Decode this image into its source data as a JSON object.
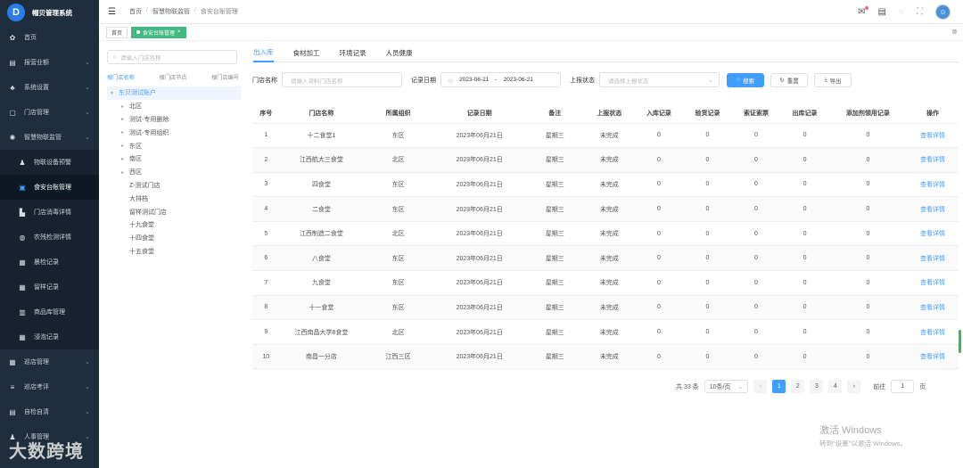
{
  "app": {
    "title": "帽贝管理系统",
    "logo_icon": "D"
  },
  "sidebar": {
    "items": [
      {
        "label": "首页",
        "icon": "home-icon",
        "glyph": "✿",
        "arrow": false
      },
      {
        "label": "报营业额",
        "icon": "document-icon",
        "glyph": "▤",
        "arrow": true
      },
      {
        "label": "系统设置",
        "icon": "user-settings-icon",
        "glyph": "♣",
        "arrow": true
      },
      {
        "label": "门店管理",
        "icon": "store-icon",
        "glyph": "▢",
        "arrow": true
      },
      {
        "label": "智慧物联监管",
        "icon": "gear-icon",
        "glyph": "✺",
        "arrow": true
      }
    ],
    "sub_items": [
      {
        "label": "物联设备预警",
        "icon": "alert-icon",
        "glyph": "♟"
      },
      {
        "label": "食安台账管理",
        "icon": "ledger-icon",
        "glyph": "▣",
        "active": true
      },
      {
        "label": "门店消毒详情",
        "icon": "disinfect-icon",
        "glyph": "▙"
      },
      {
        "label": "农残检测详情",
        "icon": "test-icon",
        "glyph": "◍"
      },
      {
        "label": "晨检记录",
        "icon": "checkup-icon",
        "glyph": "▦"
      },
      {
        "label": "留样记录",
        "icon": "sample-icon",
        "glyph": "▦"
      },
      {
        "label": "商品库管理",
        "icon": "warehouse-icon",
        "glyph": "▥"
      },
      {
        "label": "浸泡记录",
        "icon": "soak-icon",
        "glyph": "▦"
      }
    ],
    "bottom_items": [
      {
        "label": "巡店管理",
        "icon": "grid-icon",
        "glyph": "▦",
        "arrow": true
      },
      {
        "label": "巡店考评",
        "icon": "list-icon",
        "glyph": "≡",
        "arrow": true
      },
      {
        "label": "自检自清",
        "icon": "check-icon",
        "glyph": "▤",
        "arrow": true
      },
      {
        "label": "人事管理",
        "icon": "person-icon",
        "glyph": "♟",
        "arrow": true
      }
    ]
  },
  "breadcrumb": [
    "首页",
    "智慧物联监管",
    "食安台账管理"
  ],
  "tags": [
    {
      "label": "首页",
      "active": false
    },
    {
      "label": "食安台账管理",
      "active": true
    }
  ],
  "tree_panel": {
    "search_placeholder": "请输入门店名称",
    "search_tabs": [
      "搜门店名称",
      "搜门店节点",
      "搜门店编号"
    ],
    "nodes": [
      {
        "label": "东贝测试账户",
        "level": 0,
        "caret": "▾",
        "root": true
      },
      {
        "label": "北区",
        "level": 1,
        "caret": "▸"
      },
      {
        "label": "测试-专用删除",
        "level": 1,
        "caret": "▸"
      },
      {
        "label": "测试-专用组织",
        "level": 1,
        "caret": "▸"
      },
      {
        "label": "东区",
        "level": 1,
        "caret": "▸"
      },
      {
        "label": "南区",
        "level": 1,
        "caret": "▸"
      },
      {
        "label": "西区",
        "level": 1,
        "caret": "▸"
      },
      {
        "label": "Z-测试门店",
        "level": 1,
        "caret": ""
      },
      {
        "label": "大排档",
        "level": 1,
        "caret": ""
      },
      {
        "label": "留样测试门店",
        "level": 1,
        "caret": ""
      },
      {
        "label": "十九食堂",
        "level": 1,
        "caret": ""
      },
      {
        "label": "十四食堂",
        "level": 1,
        "caret": ""
      },
      {
        "label": "十五食堂",
        "level": 1,
        "caret": ""
      }
    ]
  },
  "tabs": [
    "出入库",
    "食材加工",
    "环境记录",
    "人员健康"
  ],
  "filters": {
    "store_label": "门店名称",
    "store_placeholder": "请输入资料门店名称",
    "date_label": "记录日期",
    "date_start": "2023-06-21",
    "date_sep": "-",
    "date_end": "2023-06-21",
    "status_label": "上报状态",
    "status_placeholder": "请选择上报状态",
    "search_btn": "搜索",
    "reset_btn": "重置",
    "export_btn": "导出"
  },
  "table": {
    "headers": [
      "序号",
      "门店名称",
      "所属组织",
      "记录日期",
      "备注",
      "上报状态",
      "入库记录",
      "验货记录",
      "索证索票",
      "出库记录",
      "添加剂领用记录",
      "操作"
    ],
    "rows": [
      [
        "1",
        "十二食堂1",
        "东区",
        "2023年06月21日",
        "星期三",
        "未完成",
        "0",
        "0",
        "0",
        "0",
        "0",
        "查看详情"
      ],
      [
        "2",
        "江西航大三食堂",
        "北区",
        "2023年06月21日",
        "星期三",
        "未完成",
        "0",
        "0",
        "0",
        "0",
        "0",
        "查看详情"
      ],
      [
        "3",
        "四食堂",
        "东区",
        "2023年06月21日",
        "星期三",
        "未完成",
        "0",
        "0",
        "0",
        "0",
        "0",
        "查看详情"
      ],
      [
        "4",
        "二食堂",
        "东区",
        "2023年06月21日",
        "星期三",
        "未完成",
        "0",
        "0",
        "0",
        "0",
        "0",
        "查看详情"
      ],
      [
        "5",
        "江西制造二食堂",
        "北区",
        "2023年06月21日",
        "星期三",
        "未完成",
        "0",
        "0",
        "0",
        "0",
        "0",
        "查看详情"
      ],
      [
        "6",
        "八食堂",
        "东区",
        "2023年06月21日",
        "星期三",
        "未完成",
        "0",
        "0",
        "0",
        "0",
        "0",
        "查看详情"
      ],
      [
        "7",
        "九食堂",
        "东区",
        "2023年06月21日",
        "星期三",
        "未完成",
        "0",
        "0",
        "0",
        "0",
        "0",
        "查看详情"
      ],
      [
        "8",
        "十一食堂",
        "东区",
        "2023年06月21日",
        "星期三",
        "未完成",
        "0",
        "0",
        "0",
        "0",
        "0",
        "查看详情"
      ],
      [
        "9",
        "江西南昌大学8食堂",
        "北区",
        "2023年06月21日",
        "星期三",
        "未完成",
        "0",
        "0",
        "0",
        "0",
        "0",
        "查看详情"
      ],
      [
        "10",
        "南昌一分店",
        "江西三区",
        "2023年06月21日",
        "星期三",
        "未完成",
        "0",
        "0",
        "0",
        "0",
        "0",
        "查看详情"
      ]
    ]
  },
  "pagination": {
    "total": "共 33 条",
    "page_size": "10条/页",
    "prev": "‹",
    "pages": [
      "1",
      "2",
      "3",
      "4"
    ],
    "current": "1",
    "next": "›",
    "goto_label": "前往",
    "goto_value": "1",
    "goto_suffix": "页"
  },
  "watermark": {
    "line1": "激活 Windows",
    "line2": "转到\"设置\"以激活 Windows。"
  },
  "brand_watermark": "大数跨境",
  "colors": {
    "sidebar": "#1f2d3d",
    "accent": "#409eff",
    "tag_active": "#42b983"
  }
}
